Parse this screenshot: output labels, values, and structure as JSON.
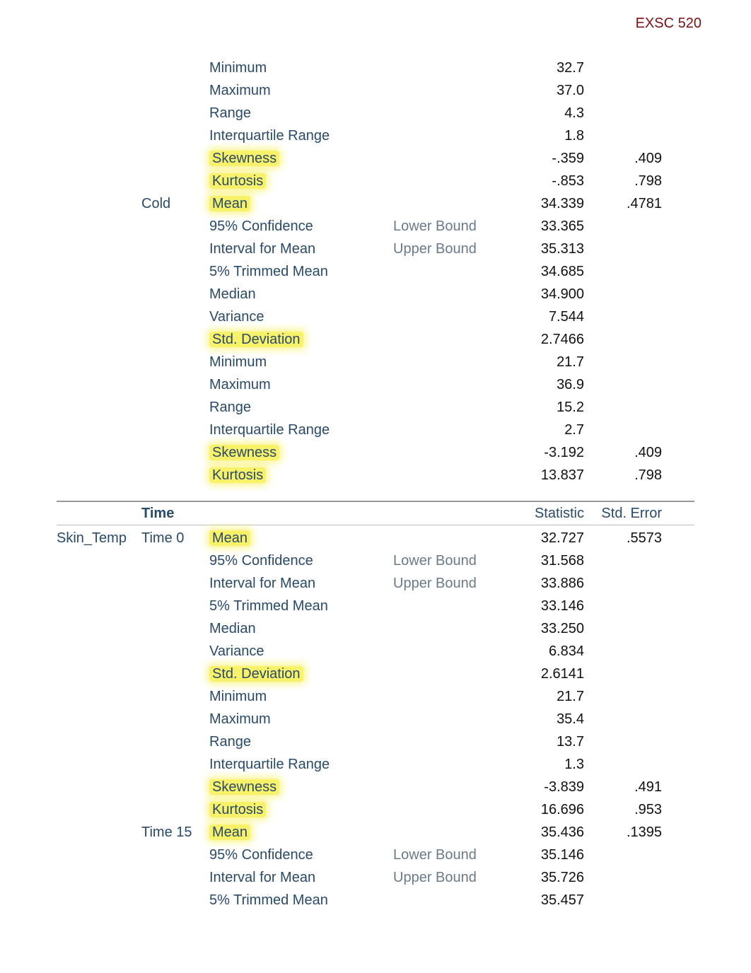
{
  "page_header": "EXSC 520",
  "section1": {
    "rows": [
      {
        "var": "",
        "time": "",
        "stat": "Minimum",
        "bound": "",
        "value": "32.7",
        "err": "",
        "hl": false
      },
      {
        "var": "",
        "time": "",
        "stat": "Maximum",
        "bound": "",
        "value": "37.0",
        "err": "",
        "hl": false
      },
      {
        "var": "",
        "time": "",
        "stat": "Range",
        "bound": "",
        "value": "4.3",
        "err": "",
        "hl": false
      },
      {
        "var": "",
        "time": "",
        "stat": "Interquartile Range",
        "bound": "",
        "value": "1.8",
        "err": "",
        "hl": false
      },
      {
        "var": "",
        "time": "",
        "stat": "Skewness",
        "bound": "",
        "value": "-.359",
        "err": ".409",
        "hl": true
      },
      {
        "var": "",
        "time": "",
        "stat": "Kurtosis",
        "bound": "",
        "value": "-.853",
        "err": ".798",
        "hl": true
      },
      {
        "var": "",
        "time": "Cold",
        "stat": "Mean",
        "bound": "",
        "value": "34.339",
        "err": ".4781",
        "hl": true
      },
      {
        "var": "",
        "time": "",
        "stat": "95% Confidence",
        "bound": "Lower Bound",
        "value": "33.365",
        "err": "",
        "hl": false
      },
      {
        "var": "",
        "time": "",
        "stat": "Interval for Mean",
        "bound": "Upper Bound",
        "value": "35.313",
        "err": "",
        "hl": false
      },
      {
        "var": "",
        "time": "",
        "stat": "5% Trimmed Mean",
        "bound": "",
        "value": "34.685",
        "err": "",
        "hl": false
      },
      {
        "var": "",
        "time": "",
        "stat": "Median",
        "bound": "",
        "value": "34.900",
        "err": "",
        "hl": false
      },
      {
        "var": "",
        "time": "",
        "stat": "Variance",
        "bound": "",
        "value": "7.544",
        "err": "",
        "hl": false
      },
      {
        "var": "",
        "time": "",
        "stat": "Std. Deviation",
        "bound": "",
        "value": "2.7466",
        "err": "",
        "hl": true
      },
      {
        "var": "",
        "time": "",
        "stat": "Minimum",
        "bound": "",
        "value": "21.7",
        "err": "",
        "hl": false
      },
      {
        "var": "",
        "time": "",
        "stat": "Maximum",
        "bound": "",
        "value": "36.9",
        "err": "",
        "hl": false
      },
      {
        "var": "",
        "time": "",
        "stat": "Range",
        "bound": "",
        "value": "15.2",
        "err": "",
        "hl": false
      },
      {
        "var": "",
        "time": "",
        "stat": "Interquartile Range",
        "bound": "",
        "value": "2.7",
        "err": "",
        "hl": false
      },
      {
        "var": "",
        "time": "",
        "stat": "Skewness",
        "bound": "",
        "value": "-3.192",
        "err": ".409",
        "hl": true
      },
      {
        "var": "",
        "time": "",
        "stat": "Kurtosis",
        "bound": "",
        "value": "13.837",
        "err": ".798",
        "hl": true
      }
    ]
  },
  "header2": {
    "time_label": "Time",
    "stat_label": "Statistic",
    "err_label": "Std. Error"
  },
  "section2": {
    "rows": [
      {
        "var": "Skin_Temp",
        "time": "Time 0",
        "stat": "Mean",
        "bound": "",
        "value": "32.727",
        "err": ".5573",
        "hl": true
      },
      {
        "var": "",
        "time": "",
        "stat": "95% Confidence",
        "bound": "Lower Bound",
        "value": "31.568",
        "err": "",
        "hl": false
      },
      {
        "var": "",
        "time": "",
        "stat": "Interval for Mean",
        "bound": "Upper Bound",
        "value": "33.886",
        "err": "",
        "hl": false
      },
      {
        "var": "",
        "time": "",
        "stat": "5% Trimmed Mean",
        "bound": "",
        "value": "33.146",
        "err": "",
        "hl": false
      },
      {
        "var": "",
        "time": "",
        "stat": "Median",
        "bound": "",
        "value": "33.250",
        "err": "",
        "hl": false
      },
      {
        "var": "",
        "time": "",
        "stat": "Variance",
        "bound": "",
        "value": "6.834",
        "err": "",
        "hl": false
      },
      {
        "var": "",
        "time": "",
        "stat": "Std. Deviation",
        "bound": "",
        "value": "2.6141",
        "err": "",
        "hl": true
      },
      {
        "var": "",
        "time": "",
        "stat": "Minimum",
        "bound": "",
        "value": "21.7",
        "err": "",
        "hl": false
      },
      {
        "var": "",
        "time": "",
        "stat": "Maximum",
        "bound": "",
        "value": "35.4",
        "err": "",
        "hl": false
      },
      {
        "var": "",
        "time": "",
        "stat": "Range",
        "bound": "",
        "value": "13.7",
        "err": "",
        "hl": false
      },
      {
        "var": "",
        "time": "",
        "stat": "Interquartile Range",
        "bound": "",
        "value": "1.3",
        "err": "",
        "hl": false
      },
      {
        "var": "",
        "time": "",
        "stat": "Skewness",
        "bound": "",
        "value": "-3.839",
        "err": ".491",
        "hl": true
      },
      {
        "var": "",
        "time": "",
        "stat": "Kurtosis",
        "bound": "",
        "value": "16.696",
        "err": ".953",
        "hl": true
      },
      {
        "var": "",
        "time": "Time 15",
        "stat": "Mean",
        "bound": "",
        "value": "35.436",
        "err": ".1395",
        "hl": true
      },
      {
        "var": "",
        "time": "",
        "stat": "95% Confidence",
        "bound": "Lower Bound",
        "value": "35.146",
        "err": "",
        "hl": false
      },
      {
        "var": "",
        "time": "",
        "stat": "Interval for Mean",
        "bound": "Upper Bound",
        "value": "35.726",
        "err": "",
        "hl": false
      },
      {
        "var": "",
        "time": "",
        "stat": "5% Trimmed Mean",
        "bound": "",
        "value": "35.457",
        "err": "",
        "hl": false
      }
    ]
  }
}
